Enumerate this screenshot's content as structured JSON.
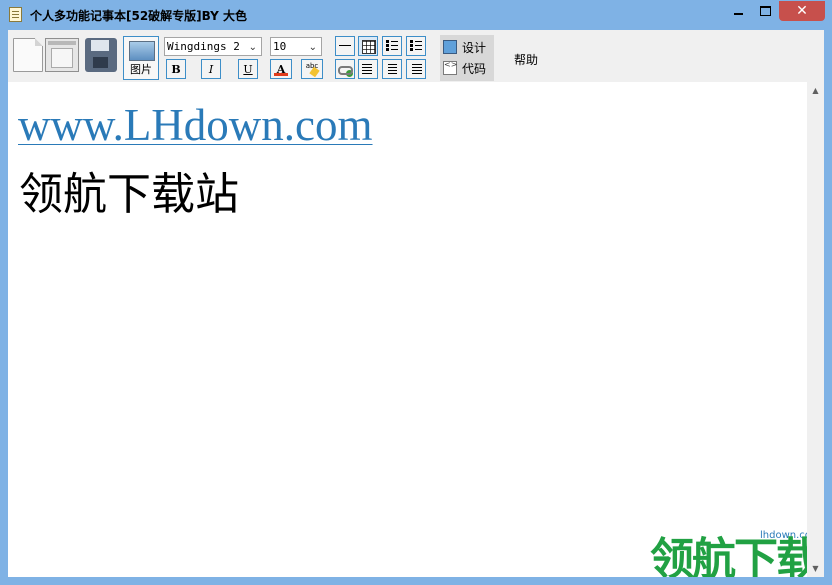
{
  "window": {
    "title": "个人多功能记事本[52破解专版]BY   大色",
    "controls": {
      "minimize": "minimize-icon",
      "maximize": "maximize-icon",
      "close": "✕"
    }
  },
  "toolbar": {
    "new_icon": "new-file-icon",
    "open_icon": "open-file-icon",
    "save_icon": "save-icon",
    "image_button_label": "图片",
    "font_combo": {
      "value": "Wingdings 2",
      "arrow": "⌄"
    },
    "size_combo": {
      "value": "10",
      "arrow": "⌄"
    },
    "format": {
      "bold": "B",
      "italic": "I",
      "underline": "U",
      "font_color": "A",
      "spellcheck": "abc"
    },
    "mode": {
      "design": "设计",
      "code": "代码"
    },
    "help_label": "帮助"
  },
  "editor": {
    "link_text": "www.LHdown.com",
    "body_text": "领航下载站"
  },
  "watermark": {
    "url": "lhdown.com",
    "text": "领航下载"
  },
  "scrollbar": {
    "up": "▲",
    "down": "▼"
  },
  "colors": {
    "title_bar": "#7fb2e5",
    "close_button": "#c7504c",
    "link": "#2a7ab8",
    "watermark": "#21a143",
    "button_border": "#3d8ec8"
  }
}
